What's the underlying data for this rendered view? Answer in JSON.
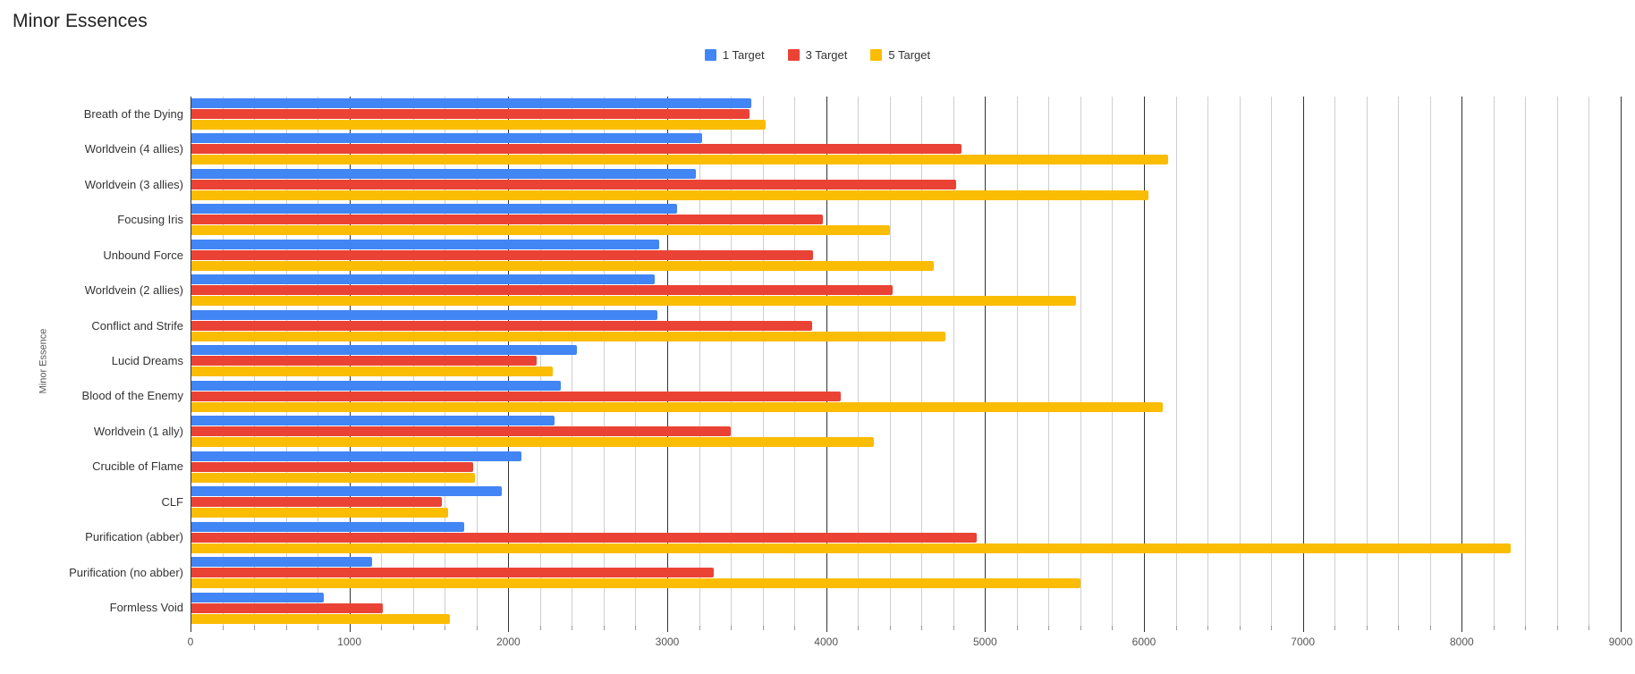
{
  "title": "Minor Essences",
  "colors": {
    "series_1": "#4285f4",
    "series_3": "#ea4335",
    "series_5": "#fbbc04",
    "gridline_minor": "#cfcfcf",
    "gridline_major": "#333333",
    "text": "#333333"
  },
  "legend": {
    "position": "top-center",
    "items": [
      {
        "label": "1 Target",
        "color": "#4285f4"
      },
      {
        "label": "3 Target",
        "color": "#ea4335"
      },
      {
        "label": "5 Target",
        "color": "#fbbc04"
      }
    ]
  },
  "axes": {
    "y_title": "Minor Essence",
    "x_title": "",
    "x_min": 0,
    "x_max": 9000,
    "x_major_step": 1000,
    "x_minor_step": 200,
    "x_ticks": [
      0,
      1000,
      2000,
      3000,
      4000,
      5000,
      6000,
      7000,
      8000,
      9000
    ],
    "x_tick_labels": [
      "0",
      "1000",
      "2000",
      "3000",
      "4000",
      "5000",
      "6000",
      "7000",
      "8000",
      "9000"
    ],
    "grid": true
  },
  "chart_data": {
    "type": "bar",
    "orientation": "horizontal",
    "title": "Minor Essences",
    "xlabel": "",
    "ylabel": "Minor Essence",
    "xlim": [
      0,
      9000
    ],
    "grid": true,
    "legend_position": "top-center",
    "categories": [
      "Breath of the Dying",
      "Worldvein (4 allies)",
      "Worldvein (3 allies)",
      "Focusing Iris",
      "Unbound Force",
      "Worldvein (2 allies)",
      "Conflict and Strife",
      "Lucid Dreams",
      "Blood of the Enemy",
      "Worldvein (1 ally)",
      "Crucible of Flame",
      "CLF",
      "Purification (abber)",
      "Purification (no abber)",
      "Formless Void"
    ],
    "series": [
      {
        "name": "1 Target",
        "color": "#4285f4",
        "values": [
          3530,
          3220,
          3180,
          3060,
          2950,
          2920,
          2940,
          2430,
          2330,
          2290,
          2080,
          1960,
          1720,
          1140,
          840
        ]
      },
      {
        "name": "3 Target",
        "color": "#ea4335",
        "values": [
          3520,
          4850,
          4820,
          3980,
          3920,
          4420,
          3910,
          2180,
          4090,
          3400,
          1780,
          1580,
          4950,
          3290,
          1210
        ]
      },
      {
        "name": "5 Target",
        "color": "#fbbc04",
        "values": [
          3620,
          6150,
          6030,
          4400,
          4680,
          5570,
          4750,
          2280,
          6120,
          4300,
          1790,
          1620,
          8310,
          5600,
          1630
        ]
      }
    ]
  }
}
